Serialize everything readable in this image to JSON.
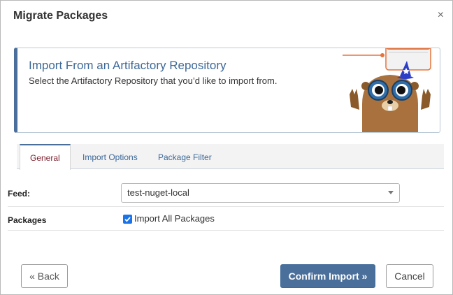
{
  "dialog": {
    "title": "Migrate Packages",
    "close_glyph": "×"
  },
  "banner": {
    "heading": "Import From an Artifactory Repository",
    "subheading": "Select the Artifactory Repository that you’d like to import from.",
    "illustration": "mascot-wizard-illustration",
    "accent_color": "#4a6f9a"
  },
  "tabs": [
    {
      "label": "General",
      "active": true
    },
    {
      "label": "Import Options",
      "active": false
    },
    {
      "label": "Package Filter",
      "active": false
    }
  ],
  "form": {
    "feed_label": "Feed:",
    "feed_value": "test-nuget-local",
    "packages_label": "Packages",
    "import_all_label": "Import All Packages",
    "import_all_checked": true
  },
  "buttons": {
    "back": "« Back",
    "confirm": "Confirm Import »",
    "cancel": "Cancel"
  },
  "colors": {
    "primary_button": "#4a6f9a",
    "active_tab_text": "#7a1f2b",
    "link_text": "#3d6898",
    "checkbox": "#1a73e8"
  }
}
